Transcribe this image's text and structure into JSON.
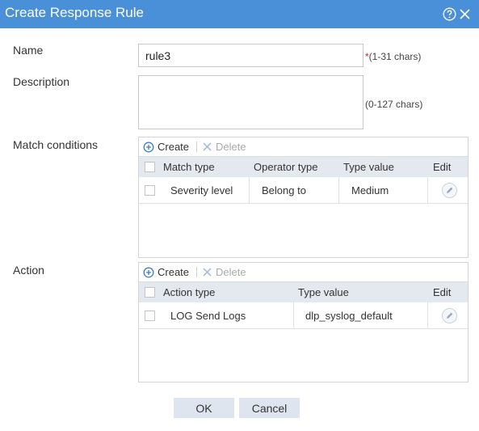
{
  "dialog": {
    "title": "Create Response Rule"
  },
  "form": {
    "name": {
      "label": "Name",
      "value": "rule3",
      "required_mark": "*",
      "hint": "(1-31 chars)"
    },
    "description": {
      "label": "Description",
      "value": "",
      "hint": "(0-127 chars)"
    },
    "match_conditions": {
      "label": "Match conditions",
      "create_label": "Create",
      "delete_label": "Delete",
      "columns": [
        "Match type",
        "Operator type",
        "Type value",
        "Edit"
      ],
      "rows": [
        {
          "match_type": "Severity level",
          "operator_type": "Belong to",
          "type_value": "Medium"
        }
      ]
    },
    "action": {
      "label": "Action",
      "create_label": "Create",
      "delete_label": "Delete",
      "columns": [
        "Action type",
        "Type value",
        "Edit"
      ],
      "rows": [
        {
          "action_type": "LOG Send Logs",
          "type_value": "dlp_syslog_default"
        }
      ]
    }
  },
  "footer": {
    "ok_label": "OK",
    "cancel_label": "Cancel"
  },
  "colors": {
    "titlebar": "#4a90d9",
    "header_row": "#e4e9ef",
    "button": "#dfe5ee",
    "required": "#e02020"
  }
}
